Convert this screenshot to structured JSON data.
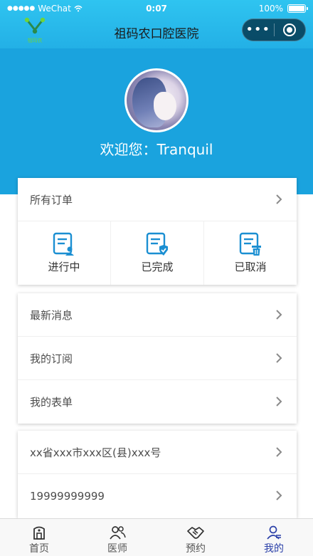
{
  "status_bar": {
    "carrier": "WeChat",
    "signal_dots": "●●●●●",
    "time": "0:07",
    "battery": "100%"
  },
  "nav": {
    "logo_text": "祖玛农",
    "title": "祖码农口腔医院",
    "more_icon": "more-dots-icon",
    "close_icon": "capsule-close-icon"
  },
  "profile": {
    "welcome": "欢迎您：Tranquil"
  },
  "orders": {
    "all_label": "所有订单",
    "statuses": [
      {
        "label": "进行中",
        "icon": "order-in-progress-icon"
      },
      {
        "label": "已完成",
        "icon": "order-completed-icon"
      },
      {
        "label": "已取消",
        "icon": "order-cancelled-icon"
      }
    ]
  },
  "menu": {
    "items": [
      {
        "label": "最新消息"
      },
      {
        "label": "我的订阅"
      },
      {
        "label": "我的表单"
      }
    ]
  },
  "info": {
    "address": "xx省xxx市xxx区(县)xxx号",
    "phone": "19999999999"
  },
  "tabbar": {
    "items": [
      {
        "label": "首页",
        "icon": "home-icon"
      },
      {
        "label": "医师",
        "icon": "doctors-icon"
      },
      {
        "label": "预约",
        "icon": "handshake-icon"
      },
      {
        "label": "我的",
        "icon": "profile-icon",
        "active": true
      }
    ],
    "active_color": "#2a3fa8"
  },
  "colors": {
    "header": "#23b0e6",
    "profile_band": "#1aa3de",
    "icon_blue": "#1b8fd2"
  }
}
